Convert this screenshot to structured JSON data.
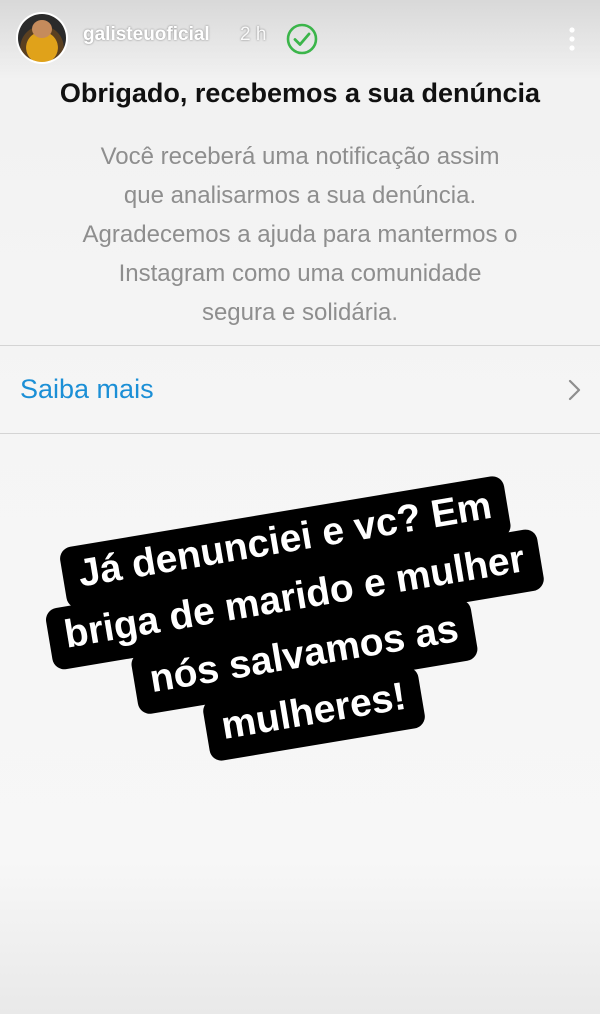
{
  "header": {
    "username": "galisteuoficial",
    "timestamp": "2 h",
    "verified_icon": "check-circle-icon",
    "more_icon": "vertical-ellipsis-icon"
  },
  "report": {
    "title": "Obrigado, recebemos a sua denúncia",
    "body_lines": [
      "Você receberá uma notificação assim",
      "que analisarmos a sua denúncia.",
      "Agradecemos a ajuda para mantermos o",
      "Instagram como uma comunidade",
      "segura e solidária."
    ],
    "learn_more_label": "Saiba mais",
    "link_color": "#1b8fd6"
  },
  "sticker": {
    "lines": [
      "Já denunciei e vc? Em",
      "briga de marido e mulher",
      "nós salvamos as",
      "mulheres!"
    ]
  }
}
